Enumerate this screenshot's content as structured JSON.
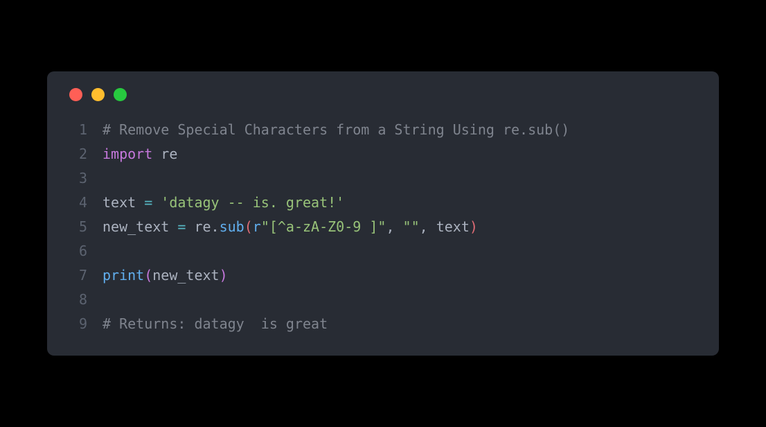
{
  "lines": [
    {
      "num": "1"
    },
    {
      "num": "2"
    },
    {
      "num": "3"
    },
    {
      "num": "4"
    },
    {
      "num": "5"
    },
    {
      "num": "6"
    },
    {
      "num": "7"
    },
    {
      "num": "8"
    },
    {
      "num": "9"
    }
  ],
  "code": {
    "line1_comment": "# Remove Special Characters from a String Using re.sub()",
    "line2_import": "import",
    "line2_re": " re",
    "line4_text": "text",
    "line4_eq": " = ",
    "line4_str": "'datagy -- is. great!'",
    "line5_newtext": "new_text",
    "line5_eq": " = ",
    "line5_re": "re",
    "line5_dot1": ".",
    "line5_sub": "sub",
    "line5_open": "(",
    "line5_r": "r",
    "line5_regex": "\"[^a-zA-Z0-9 ]\"",
    "line5_comma1": ", ",
    "line5_empty": "\"\"",
    "line5_comma2": ", ",
    "line5_textarg": "text",
    "line5_close": ")",
    "line7_print": "print",
    "line7_open": "(",
    "line7_arg": "new_text",
    "line7_close": ")",
    "line9_comment": "# Returns: datagy  is great"
  }
}
